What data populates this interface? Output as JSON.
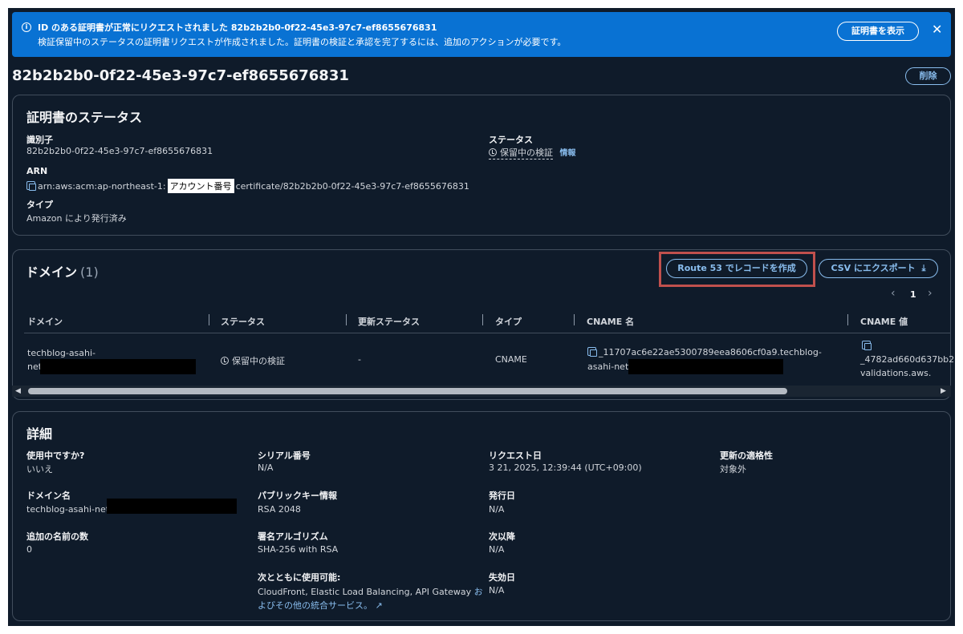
{
  "banner": {
    "title": "ID のある証明書が正常にリクエストされました 82b2b2b0-0f22-45e3-97c7-ef8655676831",
    "description": "検証保留中のステータスの証明書リクエストが作成されました。証明書の検証と承認を完了するには、追加のアクションが必要です。",
    "view_button": "証明書を表示",
    "close": "✕"
  },
  "page": {
    "title": "82b2b2b0-0f22-45e3-97c7-ef8655676831",
    "delete_button": "削除"
  },
  "status_panel": {
    "heading": "証明書のステータス",
    "identifier_label": "識別子",
    "identifier_value": "82b2b2b0-0f22-45e3-97c7-ef8655676831",
    "arn_label": "ARN",
    "arn_prefix": "arn:aws:acm:ap-northeast-1:",
    "arn_account_overlay": "アカウント番号",
    "arn_suffix": "certificate/82b2b2b0-0f22-45e3-97c7-ef8655676831",
    "type_label": "タイプ",
    "type_value": "Amazon により発行済み",
    "status_label": "ステータス",
    "status_value": "保留中の検証",
    "info_link": "情報"
  },
  "domains_panel": {
    "heading": "ドメイン",
    "count": "(1)",
    "route53_button": "Route 53 でレコードを作成",
    "csv_button": "CSV にエクスポート",
    "pagination": {
      "prev": "‹",
      "page": "1",
      "next": "›"
    },
    "columns": [
      "ドメイン",
      "ステータス",
      "更新ステータス",
      "タイプ",
      "CNAME 名",
      "CNAME 値"
    ],
    "row": {
      "domain_line1": "techblog-asahi-",
      "domain_line2": "net.",
      "status": "保留中の検証",
      "renewal_status": "-",
      "type": "CNAME",
      "cname_name_line1": "_11707ac6e22ae5300789eea8606cf0a9.techblog-",
      "cname_name_line2": "asahi-net.",
      "cname_value_line1": "_4782ad660d637bb2",
      "cname_value_line2": "validations.aws."
    },
    "highlight_color": "#c0504d"
  },
  "details_panel": {
    "heading": "詳細",
    "in_use_label": "使用中ですか?",
    "in_use_value": "いいえ",
    "domain_name_label": "ドメイン名",
    "domain_name_value": "techblog-asahi-net.",
    "additional_names_label": "追加の名前の数",
    "additional_names_value": "0",
    "serial_label": "シリアル番号",
    "serial_value": "N/A",
    "public_key_label": "パブリックキー情報",
    "public_key_value": "RSA 2048",
    "signature_label": "署名アルゴリズム",
    "signature_value": "SHA-256 with RSA",
    "usable_with_label": "次とともに使用可能:",
    "usable_with_value": "CloudFront, Elastic Load Balancing, API Gateway",
    "usable_with_link1": "お",
    "usable_with_link2": "よびその他の統合サービス。",
    "request_date_label": "リクエスト日",
    "request_date_value": "3 21, 2025, 12:39:44 (UTC+09:00)",
    "issued_label": "発行日",
    "issued_value": "N/A",
    "not_before_label": "次以降",
    "not_before_value": "N/A",
    "expiry_label": "失効日",
    "expiry_value": "N/A",
    "renewal_label": "更新の適格性",
    "renewal_value": "対象外"
  },
  "colors": {
    "background": "#0f1b2a",
    "banner": "#0972d3",
    "link": "#89bdee",
    "border": "#414d5c"
  }
}
